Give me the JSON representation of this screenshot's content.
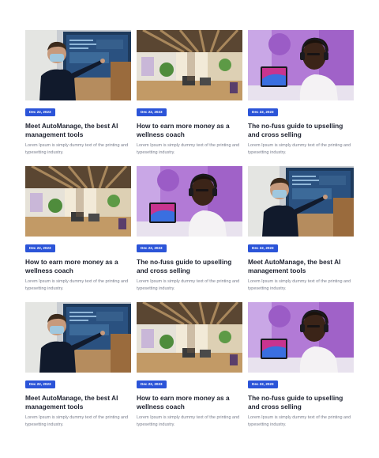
{
  "templates": {
    "meeting": {
      "title": "Meet AutoManage, the best AI management tools",
      "image": "presenter-at-screen-photo"
    },
    "coach": {
      "title": "How to earn more money as a wellness coach",
      "image": "office-interior-photo"
    },
    "upsell": {
      "title": "The no-fuss guide to upselling and cross selling",
      "image": "man-with-headphones-laptop-photo"
    }
  },
  "cards": [
    {
      "date": "Dec 22, 2023",
      "title": "Meet AutoManage, the best AI management tools",
      "excerpt": "Lorem Ipsum is simply dummy text of the printing and typesetting industry.",
      "image": "presenter-at-screen-photo"
    },
    {
      "date": "Dec 22, 2023",
      "title": "How to earn more money as a wellness coach",
      "excerpt": "Lorem Ipsum is simply dummy text of the printing and typesetting industry.",
      "image": "office-interior-photo"
    },
    {
      "date": "Dec 22, 2023",
      "title": "The no-fuss guide to upselling and cross selling",
      "excerpt": "Lorem Ipsum is simply dummy text of the printing and typesetting industry.",
      "image": "man-with-headphones-laptop-photo"
    },
    {
      "date": "Dec 22, 2023",
      "title": "How to earn more money as a wellness coach",
      "excerpt": "Lorem Ipsum is simply dummy text of the printing and typesetting industry.",
      "image": "office-interior-photo"
    },
    {
      "date": "Dec 22, 2023",
      "title": "The no-fuss guide to upselling and cross selling",
      "excerpt": "Lorem Ipsum is simply dummy text of the printing and typesetting industry.",
      "image": "man-with-headphones-laptop-photo"
    },
    {
      "date": "Dec 22, 2023",
      "title": "Meet AutoManage, the best AI management tools",
      "excerpt": "Lorem Ipsum is simply dummy text of the printing and typesetting industry.",
      "image": "presenter-at-screen-photo"
    },
    {
      "date": "Dec 22, 2023",
      "title": "Meet AutoManage, the best AI management tools",
      "excerpt": "Lorem Ipsum is simply dummy text of the printing and typesetting industry.",
      "image": "presenter-at-screen-photo"
    },
    {
      "date": "Dec 22, 2023",
      "title": "How to earn more money as a wellness coach",
      "excerpt": "Lorem Ipsum is simply dummy text of the printing and typesetting industry.",
      "image": "office-interior-photo"
    },
    {
      "date": "Dec 22, 2023",
      "title": "The no-fuss guide to upselling and cross selling",
      "excerpt": "Lorem Ipsum is simply dummy text of the printing and typesetting industry.",
      "image": "man-with-headphones-laptop-photo"
    }
  ],
  "colors": {
    "badge": "#2b54d8",
    "title": "#1e2230",
    "excerpt": "#7a7f8e",
    "background": "#ffffff"
  }
}
